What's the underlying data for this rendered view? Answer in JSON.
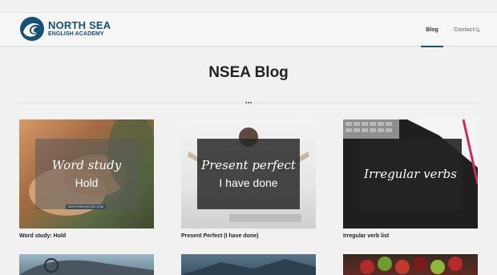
{
  "header": {
    "logo_line1": "NORTH SEA",
    "logo_line2": "ENGLISH ACADEMY",
    "nav": [
      {
        "label": "Blog",
        "active": true
      },
      {
        "label": "Contact",
        "active": false
      }
    ]
  },
  "page": {
    "title": "NSEA Blog"
  },
  "posts": [
    {
      "overlay_script": "Word study",
      "overlay_main": "Hold",
      "url_tag": "NORTHSEAENGLISH.COM",
      "title": "Word study: Hold"
    },
    {
      "overlay_script": "Present perfect",
      "overlay_main": "I have done",
      "title": "Present Perfect (I have done)"
    },
    {
      "overlay_script": "Irregular verbs",
      "overlay_main": "",
      "title": "Irregular verb list"
    }
  ],
  "colors": {
    "brand": "#184f74",
    "background": "#f1f1f1"
  }
}
